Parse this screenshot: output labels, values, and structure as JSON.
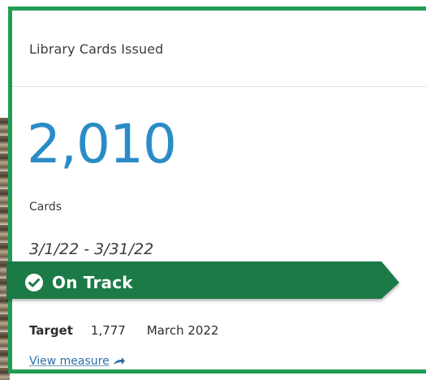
{
  "card": {
    "title": "Library Cards Issued",
    "value": "2,010",
    "unit": "Cards",
    "date_range": "3/1/22 - 3/31/22",
    "status": {
      "label": "On Track",
      "icon": "check-circle-icon",
      "color": "#1e7a46"
    },
    "target": {
      "label": "Target",
      "value": "1,777",
      "period": "March 2022"
    },
    "link": {
      "label": "View measure",
      "icon": "arrow-right-icon"
    },
    "colors": {
      "border": "#1f9d55",
      "value": "#2a8cc7",
      "link": "#2e6fa7"
    }
  }
}
